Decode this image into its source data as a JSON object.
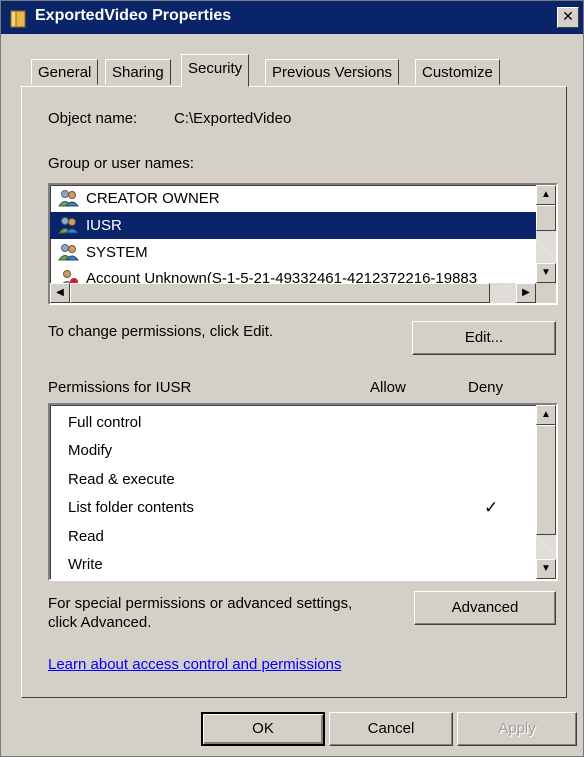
{
  "window": {
    "title": "ExportedVideo Properties",
    "close_label": "✕",
    "title_icon": "folder-icon"
  },
  "tabs": [
    {
      "label": "General",
      "active": false
    },
    {
      "label": "Sharing",
      "active": false
    },
    {
      "label": "Security",
      "active": true
    },
    {
      "label": "Previous Versions",
      "active": false
    },
    {
      "label": "Customize",
      "active": false
    }
  ],
  "security": {
    "object_name_label": "Object name:",
    "object_name_value": "C:\\ExportedVideo",
    "group_label": "Group or user names:",
    "users": [
      {
        "name": "CREATOR OWNER",
        "icon": "user-group-icon",
        "selected": false
      },
      {
        "name": "IUSR",
        "icon": "user-group-icon",
        "selected": true
      },
      {
        "name": "SYSTEM",
        "icon": "user-group-icon",
        "selected": false
      },
      {
        "name": "Account Unknown(S-1-5-21-49332461-4212372216-19883",
        "icon": "unknown-account-icon",
        "selected": false
      }
    ],
    "change_text": "To change permissions, click Edit.",
    "edit_button": "Edit...",
    "permissions_label": "Permissions for IUSR",
    "allow_header": "Allow",
    "deny_header": "Deny",
    "permissions": [
      {
        "name": "Full control",
        "allow": false,
        "deny": false
      },
      {
        "name": "Modify",
        "allow": false,
        "deny": false
      },
      {
        "name": "Read & execute",
        "allow": false,
        "deny": false
      },
      {
        "name": "List folder contents",
        "allow": false,
        "deny": true
      },
      {
        "name": "Read",
        "allow": false,
        "deny": false
      },
      {
        "name": "Write",
        "allow": false,
        "deny": false
      }
    ],
    "check_mark": "✓",
    "special_text_line1": "For special permissions or advanced settings,",
    "special_text_line2": "click Advanced.",
    "advanced_button": "Advanced",
    "learn_link": "Learn about access control and permissions"
  },
  "footer": {
    "ok_button": "OK",
    "cancel_button": "Cancel",
    "apply_button": "Apply"
  },
  "colors": {
    "titlebar": "#0a246a",
    "selection": "#0a246a",
    "dialog_face": "#d4d0c8",
    "link": "#0000ff"
  }
}
